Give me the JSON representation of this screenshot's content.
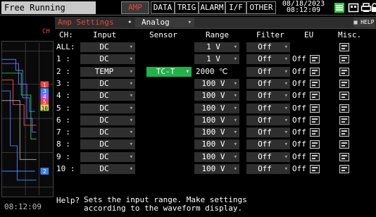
{
  "topbar": {
    "mode": "Free Running",
    "tabs": [
      "AMP",
      "DATA",
      "TRIG",
      "ALARM",
      "I/F",
      "OTHER"
    ],
    "active_tab": "AMP",
    "date": "08/18/2023",
    "time": "08:12:09"
  },
  "left": {
    "ch_label": "CH",
    "time": "08:12:09",
    "markers": [
      "1",
      "3",
      "4",
      "5",
      "10",
      "2"
    ]
  },
  "panel": {
    "title": "Amp Settings",
    "dot": "•",
    "mode": "Analog",
    "help_label": "HELP",
    "headers": {
      "ch": "CH:",
      "input": "Input",
      "sensor": "Sensor",
      "range": "Range",
      "filter": "Filter",
      "eu": "EU",
      "misc": "Misc."
    },
    "rows": [
      {
        "ch": "ALL:",
        "input": "DC",
        "range": "1 V",
        "filter": "Off",
        "eu": ""
      },
      {
        "ch": "1 :",
        "input": "DC",
        "range": "1 V",
        "filter": "Off",
        "eu": "Off"
      },
      {
        "ch": "2 :",
        "input": "TEMP",
        "sensor": "TC-T",
        "range_text": "2000 ℃",
        "filter": "Off",
        "eu": "Off"
      },
      {
        "ch": "3 :",
        "input": "DC",
        "range": "100 V",
        "filter": "Off",
        "eu": "Off"
      },
      {
        "ch": "4 :",
        "input": "DC",
        "range": "100 V",
        "filter": "Off",
        "eu": "Off"
      },
      {
        "ch": "5 :",
        "input": "DC",
        "range": "100 V",
        "filter": "Off",
        "eu": "Off"
      },
      {
        "ch": "6 :",
        "input": "DC",
        "range": "100 V",
        "filter": "Off",
        "eu": "Off"
      },
      {
        "ch": "7 :",
        "input": "DC",
        "range": "100 V",
        "filter": "Off",
        "eu": "Off"
      },
      {
        "ch": "8 :",
        "input": "DC",
        "range": "100 V",
        "filter": "Off",
        "eu": "Off"
      },
      {
        "ch": "9 :",
        "input": "DC",
        "range": "100 V",
        "filter": "Off",
        "eu": "Off"
      },
      {
        "ch": "10 :",
        "input": "DC",
        "range": "100 V",
        "filter": "Off",
        "eu": "Off"
      }
    ]
  },
  "help": {
    "prefix": "Help?",
    "message": "Sets the input range. Make settings\naccording to the waveform display."
  },
  "colors": {
    "accent": "#e8453c",
    "sensor_green": "#22b24c",
    "dropdown_bg": "#2f2f2f",
    "menu_icon_green": "#33cc44"
  },
  "icons": [
    "menu-icon",
    "screen-icon",
    "printer-icon",
    "lock-icon",
    "help-icon",
    "list-icon",
    "chevron-down-icon"
  ]
}
